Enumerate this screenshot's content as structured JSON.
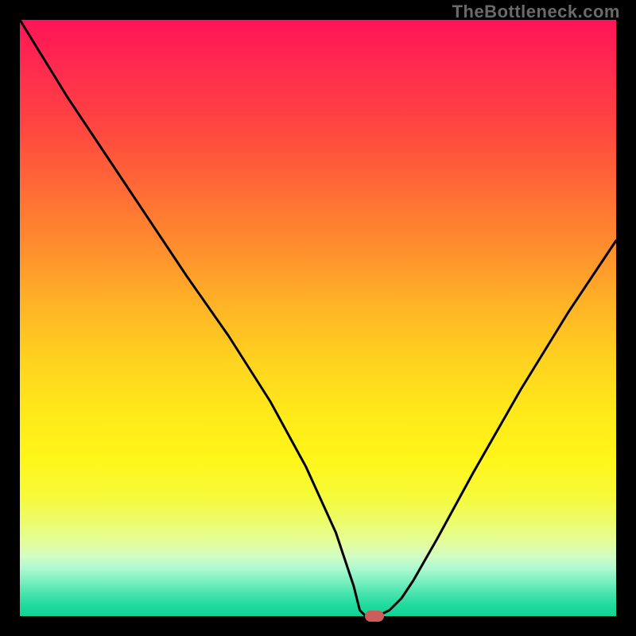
{
  "watermark": "TheBottleneck.com",
  "chart_data": {
    "type": "line",
    "title": "",
    "xlabel": "",
    "ylabel": "",
    "xlim": [
      0,
      100
    ],
    "ylim": [
      0,
      100
    ],
    "grid": false,
    "legend": false,
    "background_gradient": {
      "top_color": "#ff1457",
      "bottom_color": "#0fd493"
    },
    "series": [
      {
        "name": "bottleneck-curve",
        "color": "#000000",
        "x": [
          0,
          8,
          18,
          28,
          35,
          42,
          48,
          53,
          56,
          57,
          58,
          60,
          62,
          64,
          66,
          70,
          76,
          84,
          92,
          100
        ],
        "values": [
          100,
          87,
          72,
          57,
          47,
          36,
          25,
          14,
          5,
          1,
          0,
          0,
          1,
          3,
          6,
          13,
          24,
          38,
          51,
          63
        ]
      }
    ],
    "marker": {
      "name": "optimum-point",
      "x": 59.5,
      "y": 0,
      "color": "#cb5d5d"
    }
  }
}
